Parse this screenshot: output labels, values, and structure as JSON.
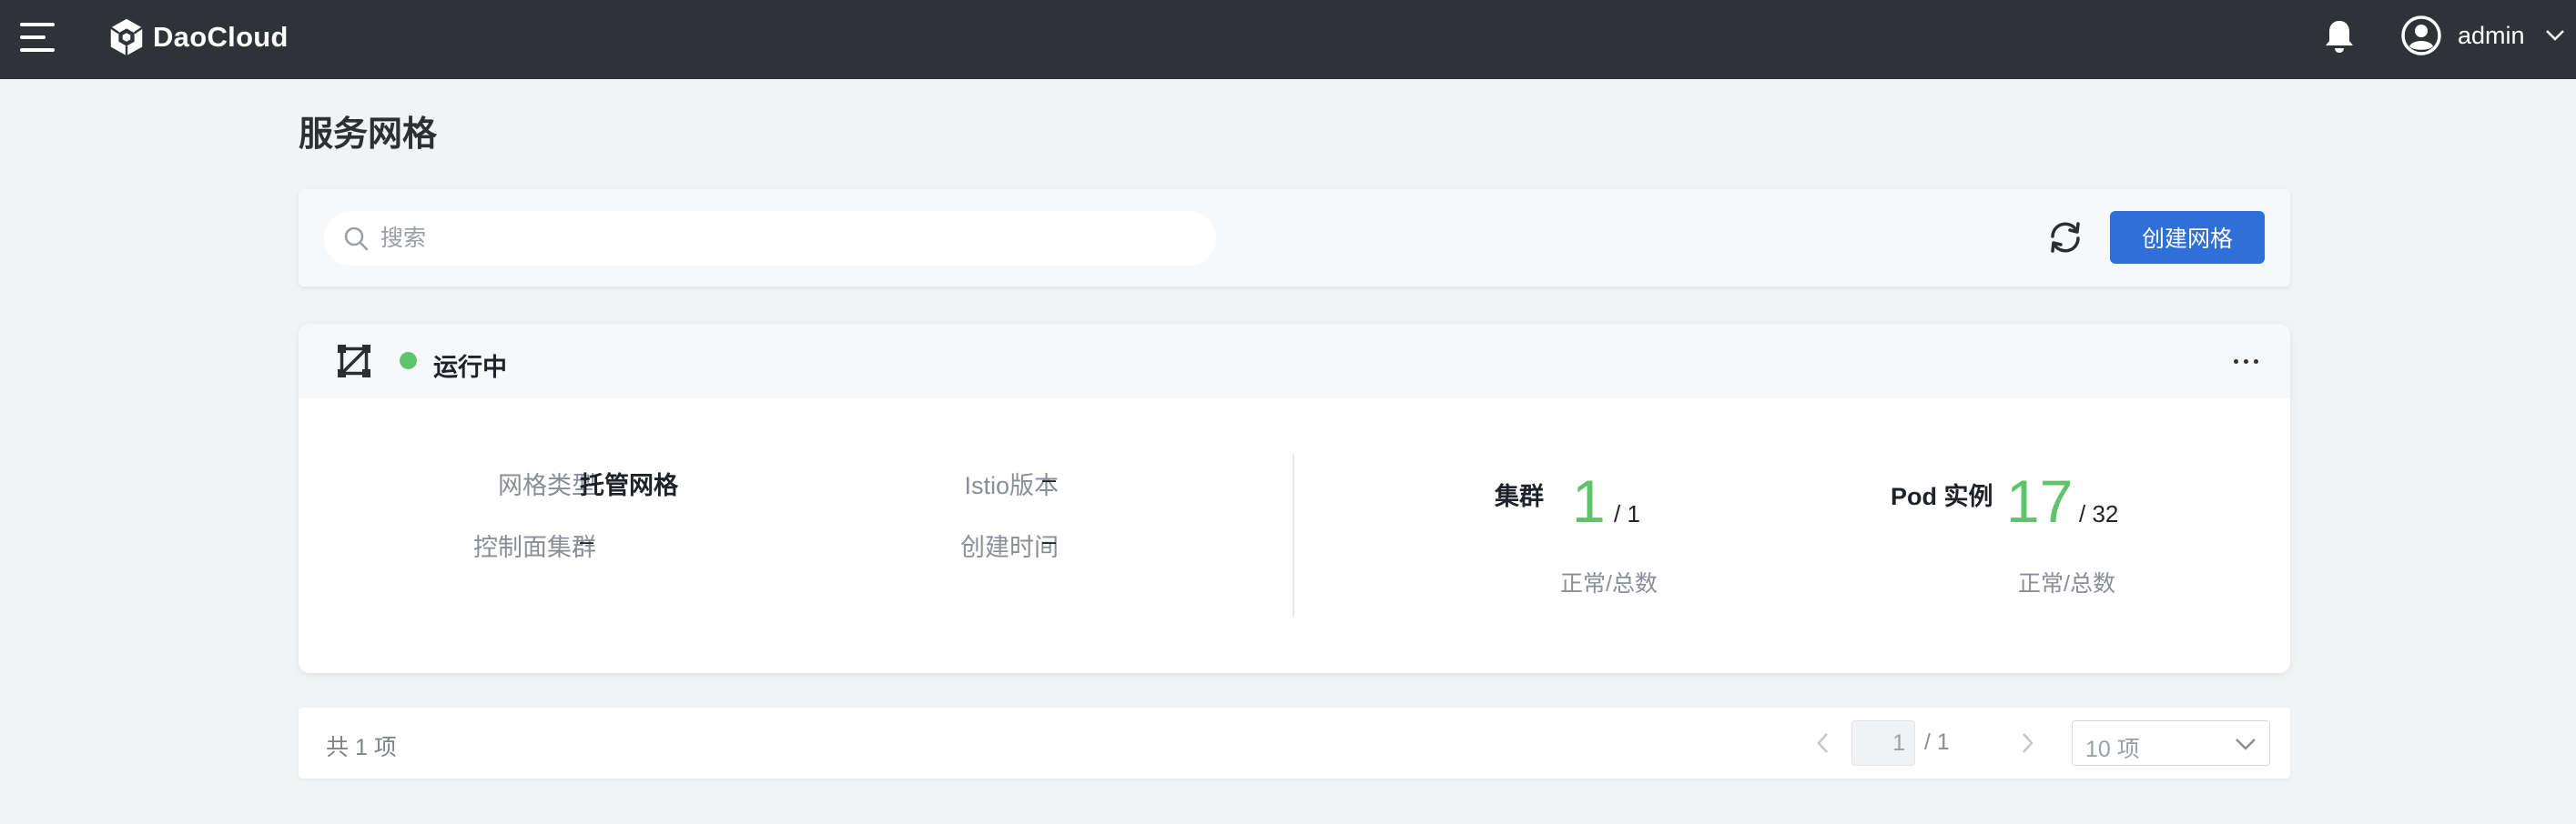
{
  "topbar": {
    "brand": "DaoCloud",
    "user_name": "admin"
  },
  "page": {
    "title": "服务网格"
  },
  "toolbar": {
    "search_placeholder": "搜索",
    "create_label": "创建网格"
  },
  "mesh_card": {
    "status": "运行中",
    "status_color": "#5ec36a",
    "fields": {
      "mesh_type_label": "网格类型",
      "mesh_type_value": "托管网格",
      "istio_version_label": "Istio版本",
      "istio_version_value": "–",
      "control_plane_label": "控制面集群",
      "control_plane_value": "–",
      "created_time_label": "创建时间",
      "created_time_value": "–"
    },
    "stats": {
      "cluster_label": "集群",
      "cluster_normal": "1",
      "cluster_total": "/ 1",
      "cluster_sub": "正常/总数",
      "pod_label": "Pod 实例",
      "pod_normal": "17",
      "pod_total": "/ 32",
      "pod_sub": "正常/总数"
    }
  },
  "pagination": {
    "total_text": "共 1 项",
    "current_page": "1",
    "page_total": "/ 1",
    "page_size": "10 项"
  },
  "colors": {
    "topbar": "#2f3237",
    "primary": "#2f6fd8",
    "success": "#5ec36a"
  },
  "icons": [
    "menu-icon",
    "daocloud-logo-icon",
    "bell-icon",
    "user-avatar-icon",
    "chevron-down-icon",
    "search-icon",
    "refresh-icon",
    "mesh-icon",
    "more-icon",
    "chevron-left-icon",
    "chevron-right-icon"
  ]
}
